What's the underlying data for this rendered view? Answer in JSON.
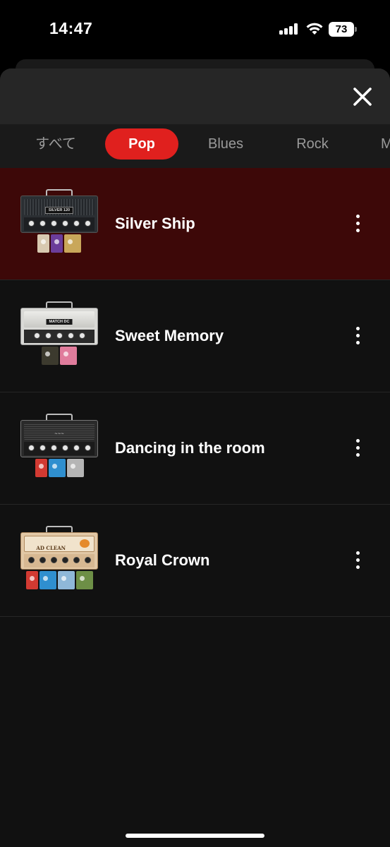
{
  "status_bar": {
    "time": "14:47",
    "battery": "73",
    "icons": [
      "cellular-signal-icon",
      "wifi-icon",
      "battery-icon"
    ]
  },
  "sheet": {
    "close_icon": "close-icon",
    "tabs": [
      {
        "label": "すべて",
        "selected": false
      },
      {
        "label": "Pop",
        "selected": true
      },
      {
        "label": "Blues",
        "selected": false
      },
      {
        "label": "Rock",
        "selected": false
      },
      {
        "label": "M",
        "selected": false
      }
    ],
    "presets": [
      {
        "title": "Silver Ship",
        "selected": true,
        "amp_name": "SILVER 120",
        "more_icon": "more-vertical-icon"
      },
      {
        "title": "Sweet Memory",
        "selected": false,
        "amp_name": "MATCH DC",
        "more_icon": "more-vertical-icon"
      },
      {
        "title": "Dancing in the room",
        "selected": false,
        "amp_name": "",
        "more_icon": "more-vertical-icon"
      },
      {
        "title": "Royal Crown",
        "selected": false,
        "amp_name": "AD CLEAN",
        "more_icon": "more-vertical-icon"
      }
    ]
  },
  "colors": {
    "accent": "#e0201e",
    "selected_row": "#3d0808",
    "background": "#111111"
  }
}
